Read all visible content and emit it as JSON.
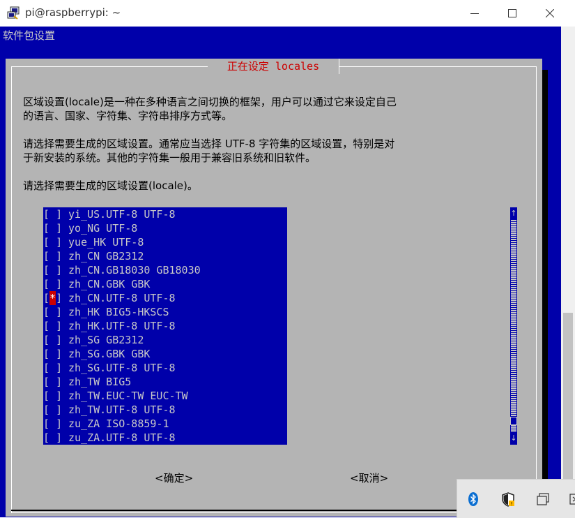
{
  "window": {
    "title": "pi@raspberrypi: ~"
  },
  "terminal": {
    "header": "软件包设置",
    "dialog": {
      "title": " 正在设定 locales ",
      "description_lines": [
        "区域设置(locale)是一种在多种语言之间切换的框架，用户可以通过它来设定自己",
        "的语言、国家、字符集、字符串排序方式等。",
        "",
        "请选择需要生成的区域设置。通常应当选择 UTF-8 字符集的区域设置，特别是对",
        "于新安装的系统。其他的字符集一般用于兼容旧系统和旧软件。",
        "",
        "请选择需要生成的区域设置(locale)。"
      ],
      "locales": [
        {
          "mark": " ",
          "label": "yi_US.UTF-8 UTF-8"
        },
        {
          "mark": " ",
          "label": "yo_NG UTF-8"
        },
        {
          "mark": " ",
          "label": "yue_HK UTF-8"
        },
        {
          "mark": " ",
          "label": "zh_CN GB2312"
        },
        {
          "mark": " ",
          "label": "zh_CN.GB18030 GB18030"
        },
        {
          "mark": " ",
          "label": "zh_CN.GBK GBK"
        },
        {
          "mark": "*",
          "label": "zh_CN.UTF-8 UTF-8"
        },
        {
          "mark": " ",
          "label": "zh_HK BIG5-HKSCS"
        },
        {
          "mark": " ",
          "label": "zh_HK.UTF-8 UTF-8"
        },
        {
          "mark": " ",
          "label": "zh_SG GB2312"
        },
        {
          "mark": " ",
          "label": "zh_SG.GBK GBK"
        },
        {
          "mark": " ",
          "label": "zh_SG.UTF-8 UTF-8"
        },
        {
          "mark": " ",
          "label": "zh_TW BIG5"
        },
        {
          "mark": " ",
          "label": "zh_TW.EUC-TW EUC-TW"
        },
        {
          "mark": " ",
          "label": "zh_TW.UTF-8 UTF-8"
        },
        {
          "mark": " ",
          "label": "zu_ZA ISO-8859-1"
        },
        {
          "mark": " ",
          "label": "zu_ZA.UTF-8 UTF-8"
        }
      ],
      "scroll_up": "↑",
      "scroll_down": "↓",
      "ok_button": "<确定>",
      "cancel_button": "<取消>"
    }
  },
  "tray": {
    "icons": [
      "bluetooth-icon",
      "security-shield-icon",
      "restore-windows-icon",
      "tray-overflow-icon"
    ]
  },
  "colors": {
    "terminal_bg": "#0000aa",
    "dialog_bg": "#b4b4b4",
    "title_red": "#cc0000",
    "list_text": "#c8c8c8"
  }
}
